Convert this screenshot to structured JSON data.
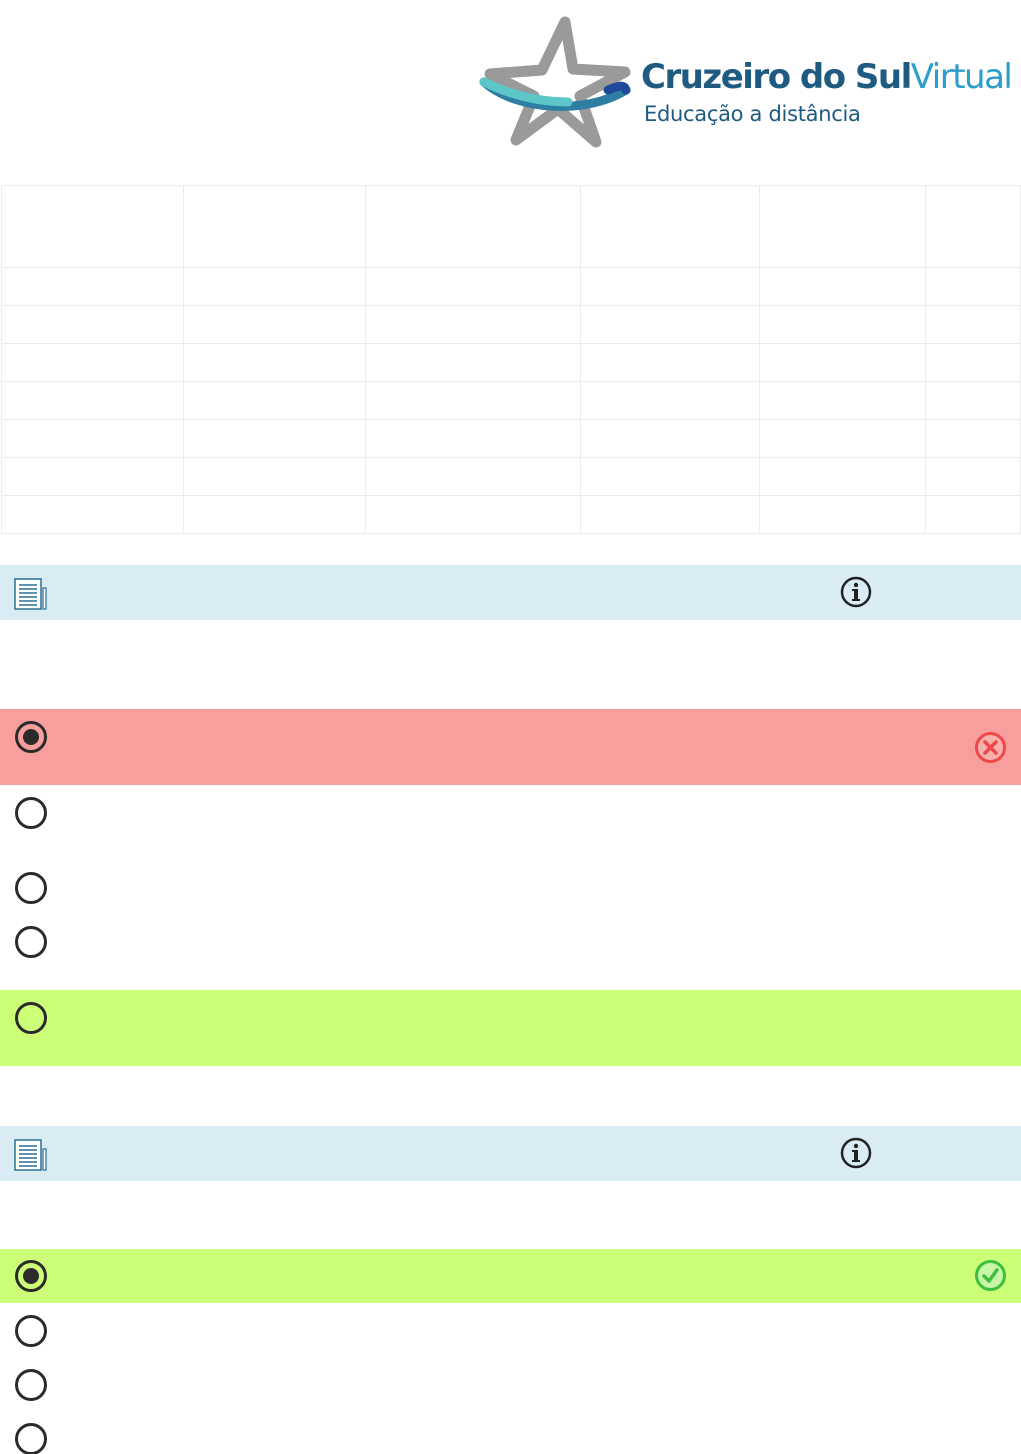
{
  "logo": {
    "brand_part1": "Cruzeiro do Sul",
    "brand_part2": "Virtual",
    "tagline": "Educação a distância",
    "colors": {
      "dark_blue": "#1f5a80",
      "light_blue": "#2c9ec9",
      "star_gray": "#9a9a9a"
    }
  },
  "summary_table": {
    "columns": 6,
    "rows": 7
  },
  "questions": [
    {
      "header_icons": [
        "document-icon",
        "info-icon"
      ],
      "options": [
        {
          "state": "selected-wrong",
          "checked": true,
          "feedback_icon": "wrong-icon"
        },
        {
          "state": "normal",
          "checked": false
        },
        {
          "state": "normal",
          "checked": false
        },
        {
          "state": "normal",
          "checked": false
        },
        {
          "state": "correct-answer",
          "checked": false
        }
      ]
    },
    {
      "header_icons": [
        "document-icon",
        "info-icon"
      ],
      "options": [
        {
          "state": "selected-correct",
          "checked": true,
          "feedback_icon": "correct-icon"
        },
        {
          "state": "normal",
          "checked": false
        },
        {
          "state": "normal",
          "checked": false
        },
        {
          "state": "normal",
          "checked": false
        }
      ]
    }
  ],
  "colors": {
    "header_bar": "#d9ecf4",
    "wrong_bg": "#f89f9d",
    "correct_bg": "#ccff77",
    "wrong_icon": "#ef4848",
    "correct_icon": "#3fbf3f"
  }
}
